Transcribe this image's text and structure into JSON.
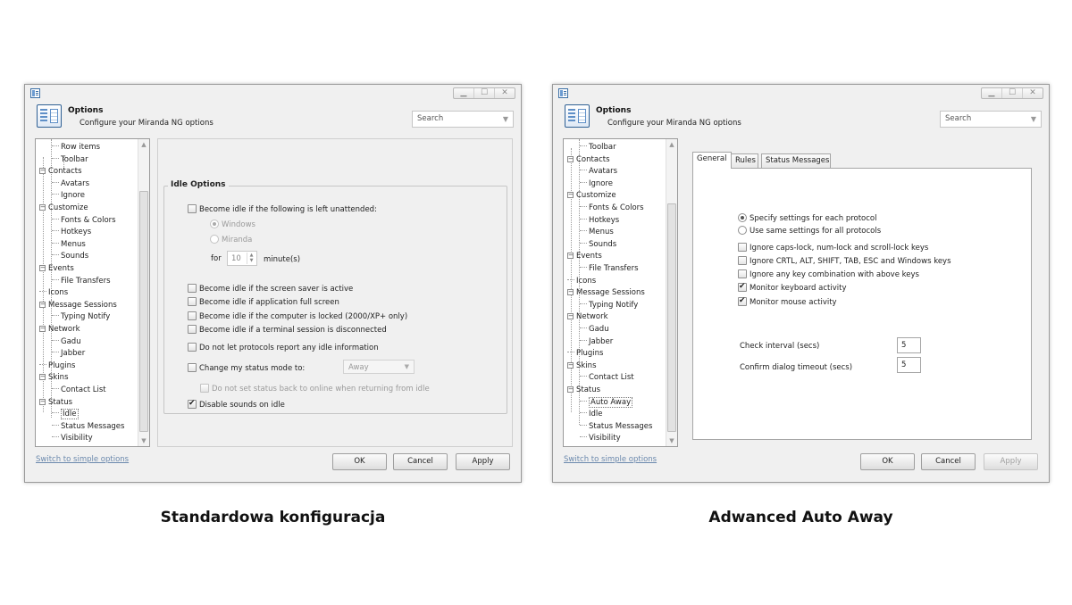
{
  "captions": {
    "left": "Standardowa konfiguracja",
    "right": "Adwanced Auto Away"
  },
  "colors": {
    "dialog_bg": "#f0f0f0",
    "link": "#6b89ad",
    "disabled_text": "#9a9a9a"
  },
  "dialog": {
    "title": "Options",
    "subtitle": "Configure your Miranda NG options",
    "search_placeholder": "Search",
    "window_controls": [
      "▁",
      "☐",
      "✕"
    ],
    "switch_link": "Switch to simple options",
    "ok": "OK",
    "cancel": "Cancel",
    "apply": "Apply"
  },
  "left": {
    "tree": [
      {
        "label": "Row items",
        "level": 2
      },
      {
        "label": "Toolbar",
        "level": 2
      },
      {
        "label": "Contacts",
        "level": 1,
        "expander": "−"
      },
      {
        "label": "Avatars",
        "level": 2
      },
      {
        "label": "Ignore",
        "level": 2
      },
      {
        "label": "Customize",
        "level": 1,
        "expander": "−"
      },
      {
        "label": "Fonts & Colors",
        "level": 2
      },
      {
        "label": "Hotkeys",
        "level": 2
      },
      {
        "label": "Menus",
        "level": 2
      },
      {
        "label": "Sounds",
        "level": 2
      },
      {
        "label": "Events",
        "level": 1,
        "expander": "−"
      },
      {
        "label": "File Transfers",
        "level": 2
      },
      {
        "label": "Icons",
        "level": 1
      },
      {
        "label": "Message Sessions",
        "level": 1,
        "expander": "−"
      },
      {
        "label": "Typing Notify",
        "level": 2
      },
      {
        "label": "Network",
        "level": 1,
        "expander": "−"
      },
      {
        "label": "Gadu",
        "level": 2
      },
      {
        "label": "Jabber",
        "level": 2
      },
      {
        "label": "Plugins",
        "level": 1
      },
      {
        "label": "Skins",
        "level": 1,
        "expander": "−"
      },
      {
        "label": "Contact List",
        "level": 2
      },
      {
        "label": "Status",
        "level": 1,
        "expander": "−"
      },
      {
        "label": "Idle",
        "level": 2,
        "selected": true
      },
      {
        "label": "Status Messages",
        "level": 2
      },
      {
        "label": "Visibility",
        "level": 2
      }
    ],
    "idle": {
      "group_title": "Idle Options",
      "become_idle_unattended": "Become idle if the following is left unattended:",
      "radio_windows": "Windows",
      "radio_miranda": "Miranda",
      "for_label": "for",
      "minutes_value": "10",
      "minutes_label": "minute(s)",
      "screen_saver": "Become idle if the screen saver is active",
      "full_screen": "Become idle if application full screen",
      "computer_locked": "Become idle if the computer is locked (2000/XP+ only)",
      "terminal_session": "Become idle if a terminal session is disconnected",
      "no_report": "Do not let protocols report any idle information",
      "change_status": "Change my status mode to:",
      "status_value": "Away",
      "no_set_back": "Do not set status back to online when returning from idle",
      "disable_sounds": "Disable sounds on idle"
    }
  },
  "right": {
    "tree": [
      {
        "label": "Toolbar",
        "level": 2
      },
      {
        "label": "Contacts",
        "level": 1,
        "expander": "−"
      },
      {
        "label": "Avatars",
        "level": 2
      },
      {
        "label": "Ignore",
        "level": 2
      },
      {
        "label": "Customize",
        "level": 1,
        "expander": "−"
      },
      {
        "label": "Fonts & Colors",
        "level": 2
      },
      {
        "label": "Hotkeys",
        "level": 2
      },
      {
        "label": "Menus",
        "level": 2
      },
      {
        "label": "Sounds",
        "level": 2
      },
      {
        "label": "Events",
        "level": 1,
        "expander": "−"
      },
      {
        "label": "File Transfers",
        "level": 2
      },
      {
        "label": "Icons",
        "level": 1
      },
      {
        "label": "Message Sessions",
        "level": 1,
        "expander": "−"
      },
      {
        "label": "Typing Notify",
        "level": 2
      },
      {
        "label": "Network",
        "level": 1,
        "expander": "−"
      },
      {
        "label": "Gadu",
        "level": 2
      },
      {
        "label": "Jabber",
        "level": 2
      },
      {
        "label": "Plugins",
        "level": 1
      },
      {
        "label": "Skins",
        "level": 1,
        "expander": "−"
      },
      {
        "label": "Contact List",
        "level": 2
      },
      {
        "label": "Status",
        "level": 1,
        "expander": "−"
      },
      {
        "label": "Auto Away",
        "level": 2,
        "selected": true
      },
      {
        "label": "Idle",
        "level": 2
      },
      {
        "label": "Status Messages",
        "level": 2
      },
      {
        "label": "Visibility",
        "level": 2
      }
    ],
    "tabs": [
      "General",
      "Rules",
      "Status Messages"
    ],
    "auto_away": {
      "specify_each": "Specify settings for each protocol",
      "same_all": "Use same settings for all protocols",
      "ignore_caps": "Ignore caps-lock, num-lock and scroll-lock keys",
      "ignore_ctrl": "Ignore CRTL, ALT, SHIFT, TAB, ESC and Windows keys",
      "ignore_combo": "Ignore any key combination with above keys",
      "monitor_keyboard": "Monitor keyboard activity",
      "monitor_mouse": "Monitor mouse activity",
      "check_interval_label": "Check interval (secs)",
      "check_interval_value": "5",
      "confirm_timeout_label": "Confirm dialog timeout (secs)",
      "confirm_timeout_value": "5"
    }
  }
}
